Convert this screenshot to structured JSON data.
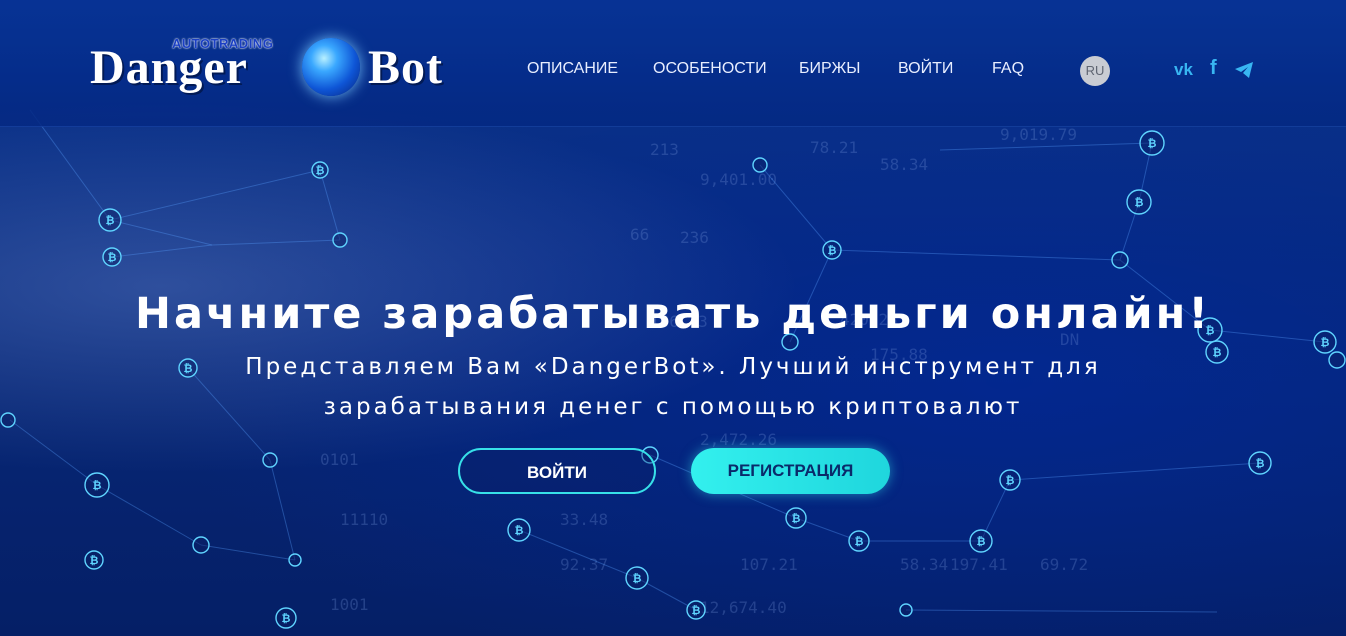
{
  "header": {
    "logo": {
      "small": "AUTOTRADING",
      "word1": "Danger",
      "word2": "Bot"
    },
    "nav": [
      {
        "label": "ОПИСАНИЕ"
      },
      {
        "label": "ОСОБЕНОСТИ"
      },
      {
        "label": "БИРЖЫ"
      },
      {
        "label": "ВОЙТИ"
      },
      {
        "label": "FAQ"
      }
    ],
    "language": "RU",
    "social": [
      "vk-icon",
      "facebook-icon",
      "telegram-icon"
    ]
  },
  "hero": {
    "title": "Начните зарабатывать деньги онлайн!",
    "subtitle_line1": "Представляем Вам «DangerBot». Лучший инструмент для",
    "subtitle_line2": "зарабатывания денег с помощью криптовалют",
    "login_label": "ВОЙТИ",
    "register_label": "РЕГИСТРАЦИЯ"
  },
  "colors": {
    "background": "#06226b",
    "accent": "#33f0ee",
    "social": "#38b6f2"
  }
}
